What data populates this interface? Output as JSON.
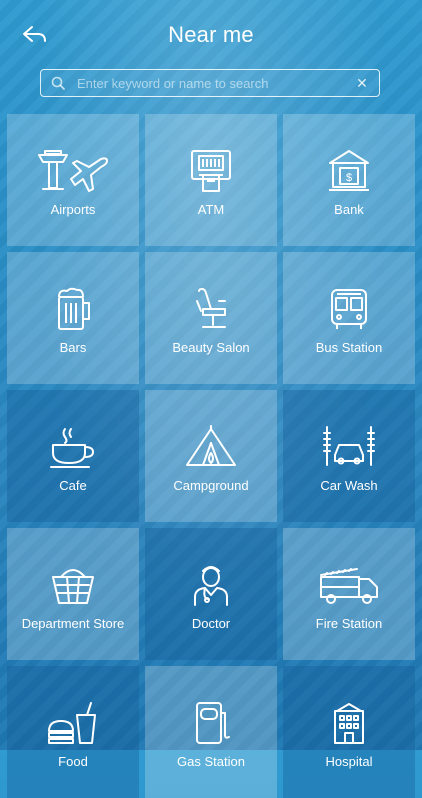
{
  "header": {
    "title": "Near me"
  },
  "search": {
    "placeholder": "Enter keyword or name to search",
    "value": ""
  },
  "categories": [
    {
      "label": "Airports",
      "icon": "airport-icon"
    },
    {
      "label": "ATM",
      "icon": "atm-icon"
    },
    {
      "label": "Bank",
      "icon": "bank-icon"
    },
    {
      "label": "Bars",
      "icon": "beer-mug-icon"
    },
    {
      "label": "Beauty Salon",
      "icon": "salon-chair-icon"
    },
    {
      "label": "Bus Station",
      "icon": "bus-icon"
    },
    {
      "label": "Cafe",
      "icon": "coffee-cup-icon"
    },
    {
      "label": "Campground",
      "icon": "tent-icon"
    },
    {
      "label": "Car Wash",
      "icon": "car-wash-icon"
    },
    {
      "label": "Department Store",
      "icon": "shopping-basket-icon"
    },
    {
      "label": "Doctor",
      "icon": "doctor-icon"
    },
    {
      "label": "Fire Station",
      "icon": "fire-truck-icon"
    },
    {
      "label": "Food",
      "icon": "fast-food-icon"
    },
    {
      "label": "Gas Station",
      "icon": "gas-pump-icon"
    },
    {
      "label": "Hospital",
      "icon": "hospital-icon"
    }
  ],
  "colors": {
    "background": "#2a8fc7",
    "tile_light": "rgba(255,255,255,0.22)",
    "tile_dark": "rgba(20,90,150,0.35)",
    "text": "#ffffff"
  }
}
